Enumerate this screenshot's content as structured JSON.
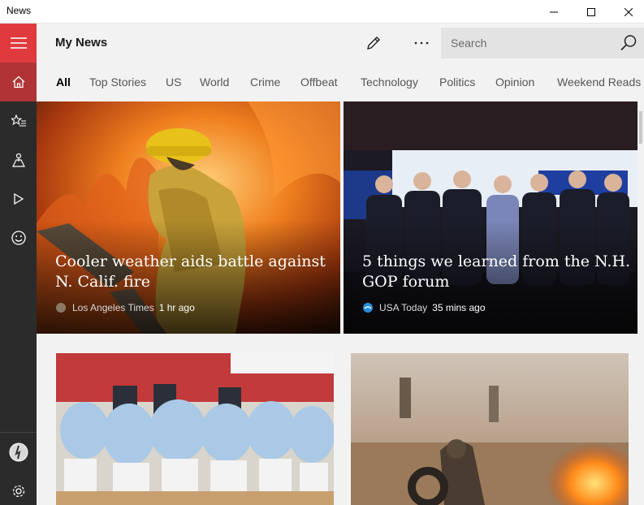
{
  "window": {
    "title": "News"
  },
  "header": {
    "title": "My News",
    "search_placeholder": "Search"
  },
  "tabs": [
    {
      "label": "All",
      "active": true
    },
    {
      "label": "Top Stories"
    },
    {
      "label": "US"
    },
    {
      "label": "World"
    },
    {
      "label": "Crime"
    },
    {
      "label": "Offbeat"
    },
    {
      "label": "Technology"
    },
    {
      "label": "Politics"
    },
    {
      "label": "Opinion"
    },
    {
      "label": "Weekend Reads"
    }
  ],
  "sidebar": {
    "items": [
      {
        "icon": "hamburger-icon"
      },
      {
        "icon": "home-icon"
      },
      {
        "icon": "interests-star-icon"
      },
      {
        "icon": "local-icon"
      },
      {
        "icon": "video-icon"
      },
      {
        "icon": "smiley-icon"
      },
      {
        "icon": "avatar-icon"
      },
      {
        "icon": "settings-icon"
      }
    ]
  },
  "stories": [
    {
      "headline": "Cooler weather aids battle against N. Calif. fire",
      "source": "Los Angeles Times",
      "time": "1 hr ago"
    },
    {
      "headline": "5 things we learned from the N.H. GOP forum",
      "source": "USA Today",
      "time": "35 mins ago"
    }
  ],
  "colors": {
    "accent": "#e03a3e",
    "accent_dark": "#b03335",
    "sidebar": "#2b2b2b",
    "background": "#f2f2f2"
  }
}
